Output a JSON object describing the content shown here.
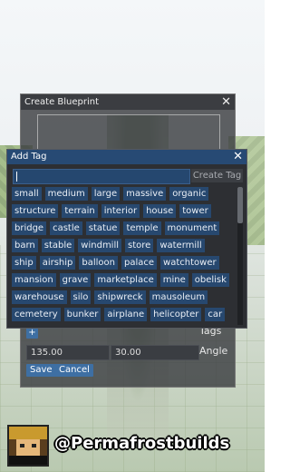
{
  "blueprint_dialog": {
    "title": "Create Blueprint",
    "close_glyph": "✕",
    "add_tag_glyph": "+",
    "tags_label": "Tags",
    "angle_values": [
      "135.00",
      "30.00"
    ],
    "angle_label": "Angle",
    "save_label": "Save",
    "cancel_label": "Cancel"
  },
  "add_tag_dialog": {
    "title": "Add Tag",
    "close_glyph": "✕",
    "input_value": "",
    "create_button_label": "Create Tag",
    "tags": [
      "small",
      "medium",
      "large",
      "massive",
      "organic",
      "structure",
      "terrain",
      "interior",
      "house",
      "tower",
      "bridge",
      "castle",
      "statue",
      "temple",
      "monument",
      "barn",
      "stable",
      "windmill",
      "store",
      "watermill",
      "ship",
      "airship",
      "balloon",
      "palace",
      "watchtower",
      "mansion",
      "grave",
      "marketplace",
      "mine",
      "obelisk",
      "warehouse",
      "silo",
      "shipwreck",
      "mausoleum",
      "cemetery",
      "bunker",
      "airplane",
      "helicopter",
      "car"
    ]
  },
  "watermark": {
    "handle": "@Permafrostbuilds"
  },
  "colors": {
    "accent": "#3e6fa3",
    "tag_bg": "#27486f",
    "titlebar": "#274a74"
  }
}
